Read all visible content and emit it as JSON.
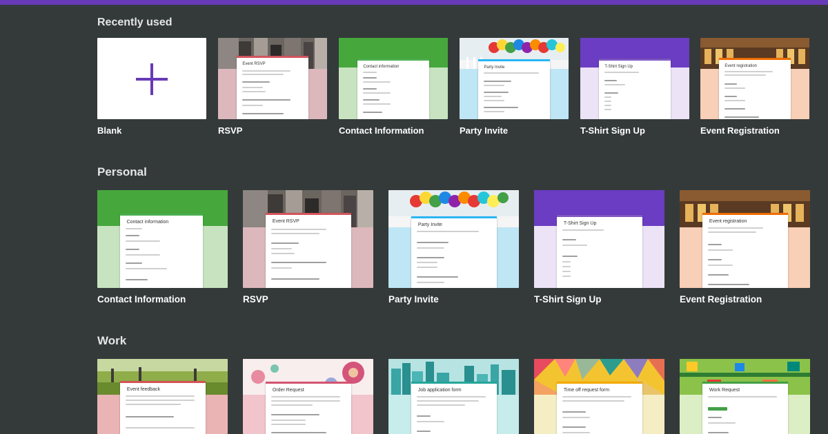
{
  "sections": {
    "recent": {
      "title": "Recently used"
    },
    "personal": {
      "title": "Personal"
    },
    "work": {
      "title": "Work"
    }
  },
  "recent": [
    {
      "name": "Blank"
    },
    {
      "name": "RSVP",
      "form_title": "Event RSVP"
    },
    {
      "name": "Contact Information",
      "form_title": "Contact information"
    },
    {
      "name": "Party Invite",
      "form_title": "Party Invite"
    },
    {
      "name": "T-Shirt Sign Up",
      "form_title": "T-Shirt Sign Up"
    },
    {
      "name": "Event Registration",
      "form_title": "Event registration"
    }
  ],
  "personal": [
    {
      "name": "Contact Information",
      "form_title": "Contact information"
    },
    {
      "name": "RSVP",
      "form_title": "Event RSVP"
    },
    {
      "name": "Party Invite",
      "form_title": "Party Invite"
    },
    {
      "name": "T-Shirt Sign Up",
      "form_title": "T-Shirt Sign Up"
    },
    {
      "name": "Event Registration",
      "form_title": "Event registration"
    }
  ],
  "work": [
    {
      "form_title": "Event feedback"
    },
    {
      "form_title": "Order Request"
    },
    {
      "form_title": "Job application form"
    },
    {
      "form_title": "Time off request form"
    },
    {
      "form_title": "Work Request"
    }
  ],
  "colors": {
    "accent": "#673ab7",
    "background": "#343a3a"
  }
}
